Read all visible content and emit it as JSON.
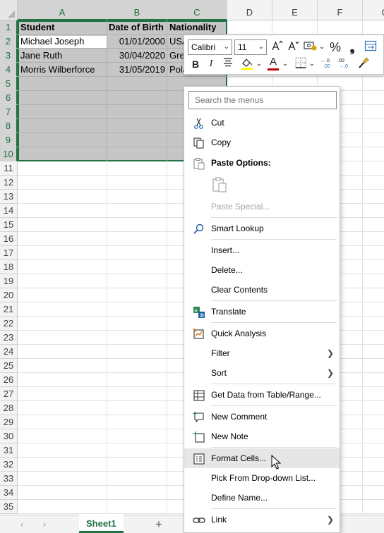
{
  "sheet": {
    "columns": [
      "A",
      "B",
      "C",
      "D",
      "E",
      "F",
      "G"
    ],
    "rows": [
      "1",
      "2",
      "3",
      "4",
      "5",
      "6",
      "7",
      "8",
      "9",
      "10",
      "11",
      "12",
      "13",
      "14",
      "15",
      "16",
      "17",
      "18",
      "19",
      "20",
      "21",
      "22",
      "23",
      "24",
      "25",
      "26",
      "27",
      "28",
      "29",
      "30",
      "31",
      "32",
      "33",
      "34",
      "35"
    ],
    "cells": {
      "a1": "Student",
      "b1": "Date of Birth",
      "c1": "Nationality",
      "a2": "Michael Joseph",
      "b2": "01/01/2000",
      "c2": "USA",
      "a3": "Jane Ruth",
      "b3": "30/04/2020",
      "c3": "Great Britain",
      "a4": "Morris Wilberforce",
      "b4": "31/05/2019",
      "c4": "Poland"
    }
  },
  "tabs": {
    "sheet1": "Sheet1",
    "add": "+",
    "prev": "‹",
    "next": "›"
  },
  "mini_toolbar": {
    "font_name": "Calibri",
    "font_size": "11",
    "percent": "%",
    "comma": "❟",
    "bold": "B",
    "italic": "I",
    "font_color_letter": "A",
    "font_color": "#C00000",
    "fill_color": "#FFFF00"
  },
  "context_menu": {
    "search_placeholder": "Search the menus",
    "items": {
      "cut": "Cut",
      "copy": "Copy",
      "paste_options": "Paste Options:",
      "paste_special": "Paste Special...",
      "smart_lookup": "Smart Lookup",
      "insert": "Insert...",
      "delete": "Delete...",
      "clear_contents": "Clear Contents",
      "translate": "Translate",
      "quick_analysis": "Quick Analysis",
      "filter": "Filter",
      "sort": "Sort",
      "get_data": "Get Data from Table/Range...",
      "new_comment": "New Comment",
      "new_note": "New Note",
      "format_cells": "Format Cells...",
      "pick_list": "Pick From Drop-down List...",
      "define_name": "Define Name...",
      "link": "Link"
    }
  },
  "colors": {
    "accent": "#217346",
    "selection": "#C6C6C6"
  }
}
